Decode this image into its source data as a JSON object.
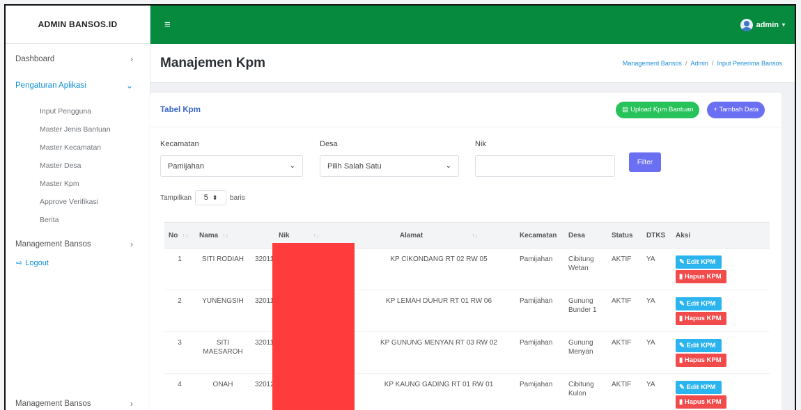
{
  "brand": "ADMIN BANSOS.ID",
  "sidebar": {
    "items": [
      {
        "label": "Dashboard",
        "chevron": "›"
      },
      {
        "label": "Pengaturan Aplikasi",
        "chevron": "⌄"
      }
    ],
    "sub_items": [
      "Input Pengguna",
      "Master Jenis Bantuan",
      "Master Kecamatan",
      "Master Desa",
      "Master Kpm",
      "Approve Verifikasi",
      "Berita"
    ],
    "management": "Management Bansos",
    "logout": "Logout",
    "bottom_item": "Management Bansos"
  },
  "topbar": {
    "hamburger": "≡",
    "user": "admin"
  },
  "header": {
    "title": "Manajemen Kpm",
    "breadcrumb": [
      "Management Bansos",
      "Admin",
      "Input Penerima Bansos"
    ],
    "sep": "/"
  },
  "card": {
    "title": "Tabel Kpm",
    "upload_label": "Upload Kpm Bantuan",
    "add_label": "+ Tambah Data"
  },
  "filters": {
    "kecamatan_label": "Kecamatan",
    "kecamatan_value": "Pamijahan",
    "desa_label": "Desa",
    "desa_value": "Pilih Salah Satu",
    "nik_label": "Nik",
    "nik_value": "",
    "filter_button": "Filter"
  },
  "length": {
    "prefix": "Tampilkan",
    "value": "5",
    "suffix": "baris"
  },
  "table": {
    "headers": [
      "No",
      "Nama",
      "Nik",
      "Alamat",
      "Kecamatan",
      "Desa",
      "Status",
      "DTKS",
      "Aksi"
    ],
    "rows": [
      {
        "no": "1",
        "nama": "SITI RODIAH",
        "nik": "32011",
        "alamat": "KP CIKONDANG RT 02 RW 05",
        "kecamatan": "Pamijahan",
        "desa": "Cibitung Wetan",
        "status": "AKTIF",
        "dtks": "YA"
      },
      {
        "no": "2",
        "nama": "YUNENGSIH",
        "nik": "32011",
        "alamat": "KP LEMAH DUHUR RT 01 RW 06",
        "kecamatan": "Pamijahan",
        "desa": "Gunung Bunder 1",
        "status": "AKTIF",
        "dtks": "YA"
      },
      {
        "no": "3",
        "nama": "SITI MAESAROH",
        "nik": "32011",
        "alamat": "KP GUNUNG MENYAN RT 03 RW 02",
        "kecamatan": "Pamijahan",
        "desa": "Gunung Menyan",
        "status": "AKTIF",
        "dtks": "YA"
      },
      {
        "no": "4",
        "nama": "ONAH",
        "nik": "32012",
        "alamat": "KP KAUNG GADING RT 01 RW 01",
        "kecamatan": "Pamijahan",
        "desa": "Cibitung Kulon",
        "status": "AKTIF",
        "dtks": "YA"
      }
    ],
    "edit_label": "Edit KPM",
    "hapus_label": "Hapus KPM",
    "sort_glyph": "↑↓"
  },
  "colors": {
    "topbar": "#068a3e",
    "accent": "#0d8fd6",
    "redaction": "#ff3b3b",
    "edit": "#2cb4ef",
    "hapus": "#f24b4b"
  }
}
